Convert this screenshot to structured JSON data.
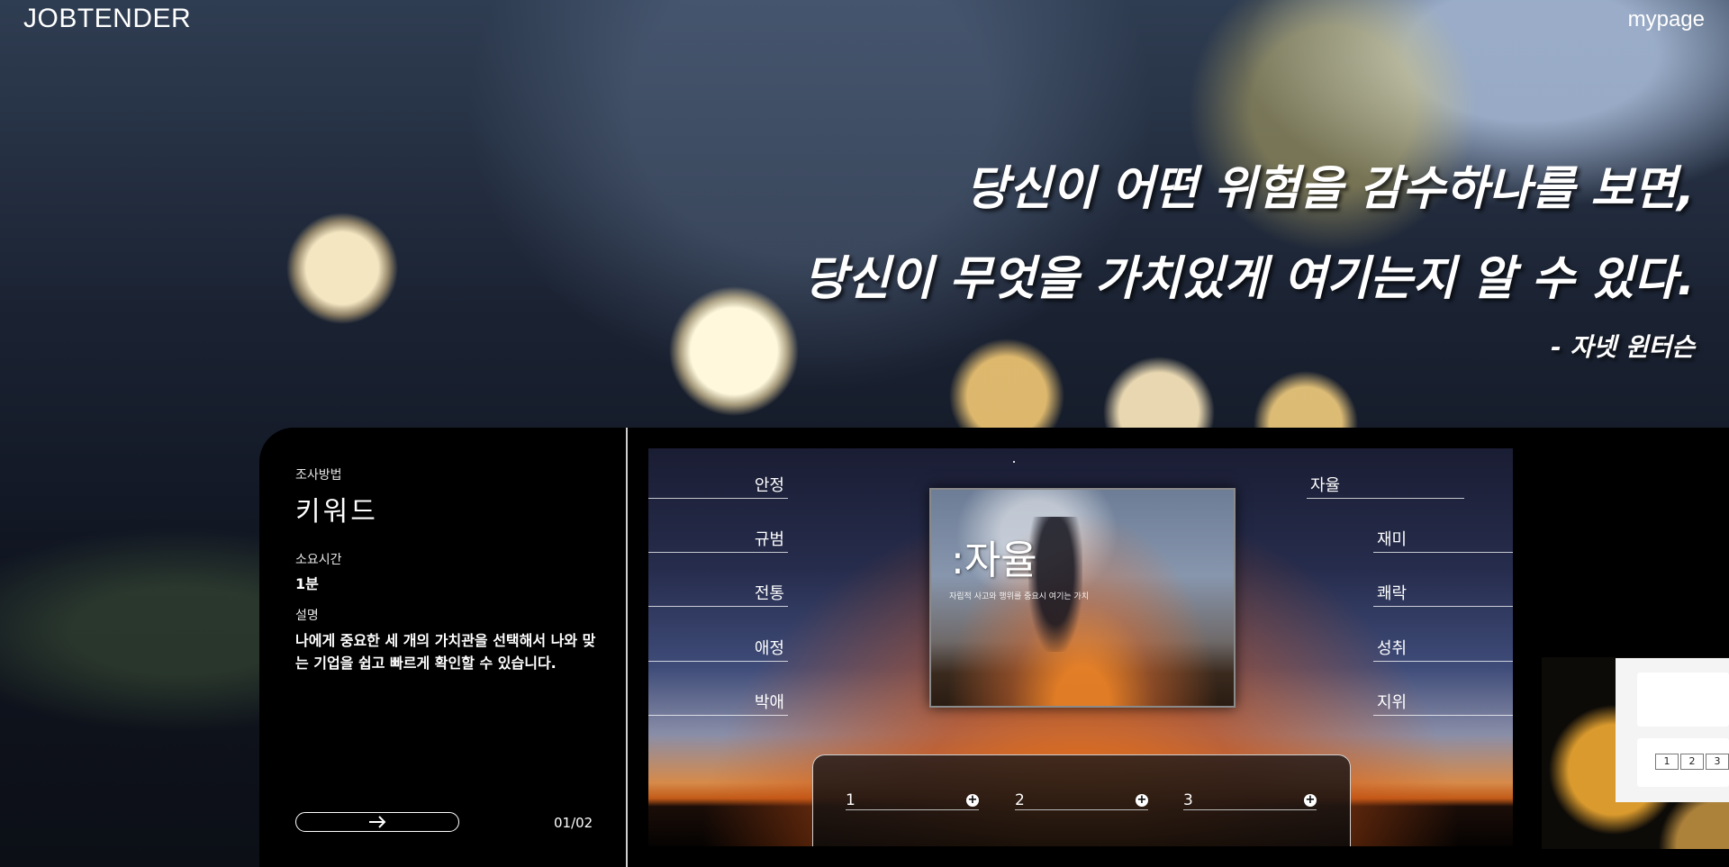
{
  "header": {
    "brand": "JOBTENDER",
    "mypage": "mypage"
  },
  "quote": {
    "line1": "당신이 어떤 위험을 감수하나를 보면,",
    "line2": "당신이 무엇을 가치있게 여기는지 알 수 있다.",
    "author": "- 자넷 윈터슨"
  },
  "info": {
    "method_label": "조사방법",
    "method_value": "키워드",
    "time_label": "소요시간",
    "time_value": "1분",
    "desc_label": "설명",
    "desc_value": "나에게 중요한 세 개의 가치관을 선택해서 나와 맞는 기업을 쉽고 빠르게 확인할 수 있습니다.",
    "next_icon": "arrow-right-icon",
    "pager": "01/02"
  },
  "keywords_left": [
    "안정",
    "규범",
    "전통",
    "애정",
    "박애"
  ],
  "keywords_right": [
    "자율",
    "재미",
    "쾌락",
    "성취",
    "지위"
  ],
  "card": {
    "title": ":자율",
    "subtitle": "자립적 사고와 행위를 중요시 여기는 가치"
  },
  "slots": [
    {
      "label": "1",
      "icon": "plus-icon"
    },
    {
      "label": "2",
      "icon": "plus-icon"
    },
    {
      "label": "3",
      "icon": "plus-icon"
    }
  ],
  "side_widget": {
    "pages": [
      "1",
      "2",
      "3"
    ]
  }
}
